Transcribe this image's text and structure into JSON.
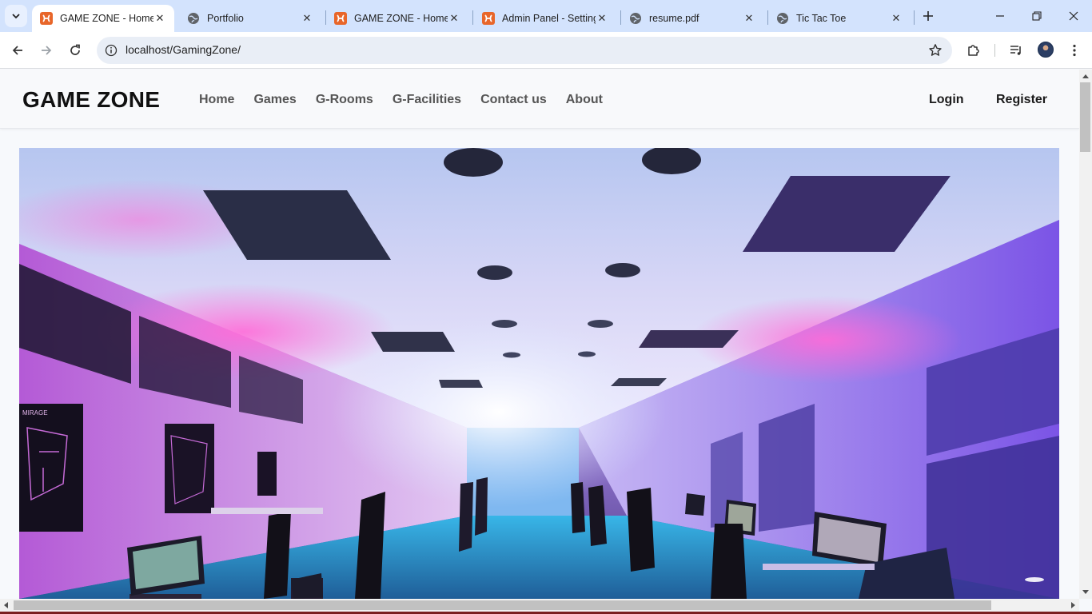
{
  "browser": {
    "tabs": [
      {
        "title": "GAME ZONE - Home",
        "icon": "xampp-icon",
        "active": true
      },
      {
        "title": "Portfolio",
        "icon": "globe-icon",
        "active": false
      },
      {
        "title": "GAME ZONE - Home",
        "icon": "xampp-icon",
        "active": false
      },
      {
        "title": "Admin Panel - Setting",
        "icon": "xampp-icon",
        "active": false
      },
      {
        "title": "resume.pdf",
        "icon": "globe-icon",
        "active": false
      },
      {
        "title": "Tic Tac Toe",
        "icon": "globe-icon",
        "active": false
      }
    ],
    "url": "localhost/GamingZone/",
    "colors": {
      "tabstrip": "#d3e3fd",
      "omnibox": "#e9eef6",
      "xampp_orange": "#e8662a"
    }
  },
  "site": {
    "brand": "GAME ZONE",
    "nav": [
      "Home",
      "Games",
      "G-Rooms",
      "G-Facilities",
      "Contact us",
      "About"
    ],
    "auth": {
      "login": "Login",
      "register": "Register"
    },
    "hero": {
      "poster_text": "MIRAGE"
    }
  }
}
